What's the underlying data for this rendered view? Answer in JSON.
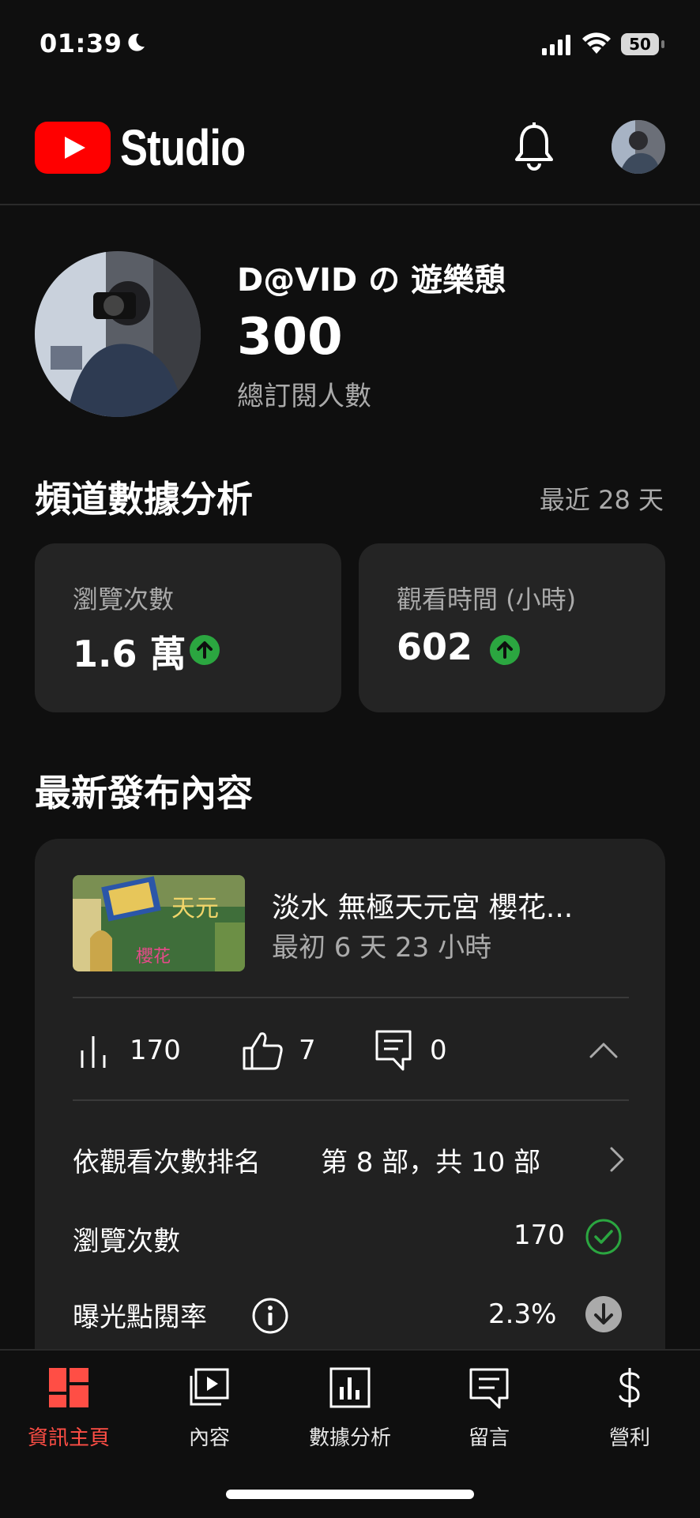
{
  "status_bar": {
    "time": "01:39",
    "battery": "50"
  },
  "header": {
    "brand": "Studio"
  },
  "channel": {
    "name": "D@VID の 遊樂憩",
    "subscribers": "300",
    "subscribers_label": "總訂閱人數"
  },
  "analytics": {
    "title": "頻道數據分析",
    "period": "最近 28 天",
    "cards": [
      {
        "label": "瀏覽次數",
        "value": "1.6 萬",
        "trend": "up"
      },
      {
        "label": "觀看時間 (小時)",
        "value": "602",
        "trend": "up"
      }
    ]
  },
  "latest": {
    "title": "最新發布內容",
    "video": {
      "title": "淡水 無極天元宮 櫻花...",
      "age": "最初 6 天 23 小時",
      "views": "170",
      "likes": "7",
      "comments": "0"
    },
    "rows": [
      {
        "label": "依觀看次數排名",
        "value": "第 8 部，共 10 部"
      },
      {
        "label": "瀏覽次數",
        "value": "170"
      },
      {
        "label": "曝光點閱率",
        "value": "2.3%"
      }
    ]
  },
  "nav": {
    "items": [
      {
        "label": "資訊主頁",
        "icon": "dashboard-icon",
        "active": true
      },
      {
        "label": "內容",
        "icon": "content-icon"
      },
      {
        "label": "數據分析",
        "icon": "analytics-icon"
      },
      {
        "label": "留言",
        "icon": "comments-icon"
      },
      {
        "label": "營利",
        "icon": "dollar-icon"
      }
    ]
  },
  "colors": {
    "accent": "#ff4e45",
    "youtube_red": "#ff0000",
    "positive": "#2ba640",
    "card": "#242424"
  }
}
